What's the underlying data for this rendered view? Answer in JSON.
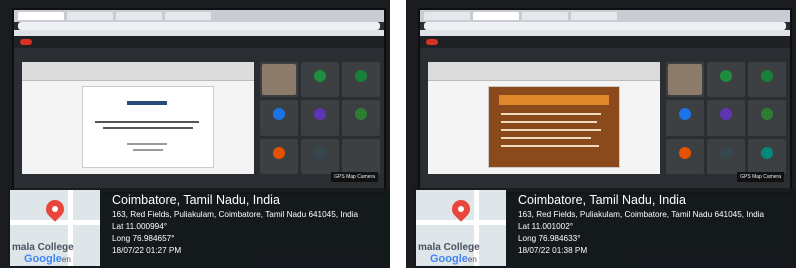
{
  "photos": [
    {
      "city": "Coimbatore, Tamil Nadu, India",
      "address": "163, Red Fields, Puliakulam, Coimbatore, Tamil Nadu 641045, India",
      "lat": "Lat 11.000994°",
      "long": "Long 76.984657°",
      "datetime": "18/07/22 01:27 PM",
      "map_label": "mala College",
      "google": "Google",
      "google_suffix": "en",
      "badge": "GPS Map Camera"
    },
    {
      "city": "Coimbatore, Tamil Nadu, India",
      "address": "163, Red Fields, Puliakulam, Coimbatore, Tamil Nadu 641045, India",
      "lat": "Lat 11.001002°",
      "long": "Long 76.984633°",
      "datetime": "18/07/22 01:38 PM",
      "map_label": "mala College",
      "google": "Google",
      "google_suffix": "en",
      "badge": "GPS Map Camera"
    }
  ],
  "colors": {
    "pin": "#e8453c",
    "google_blue": "#4285f4",
    "record": "#d93025"
  }
}
